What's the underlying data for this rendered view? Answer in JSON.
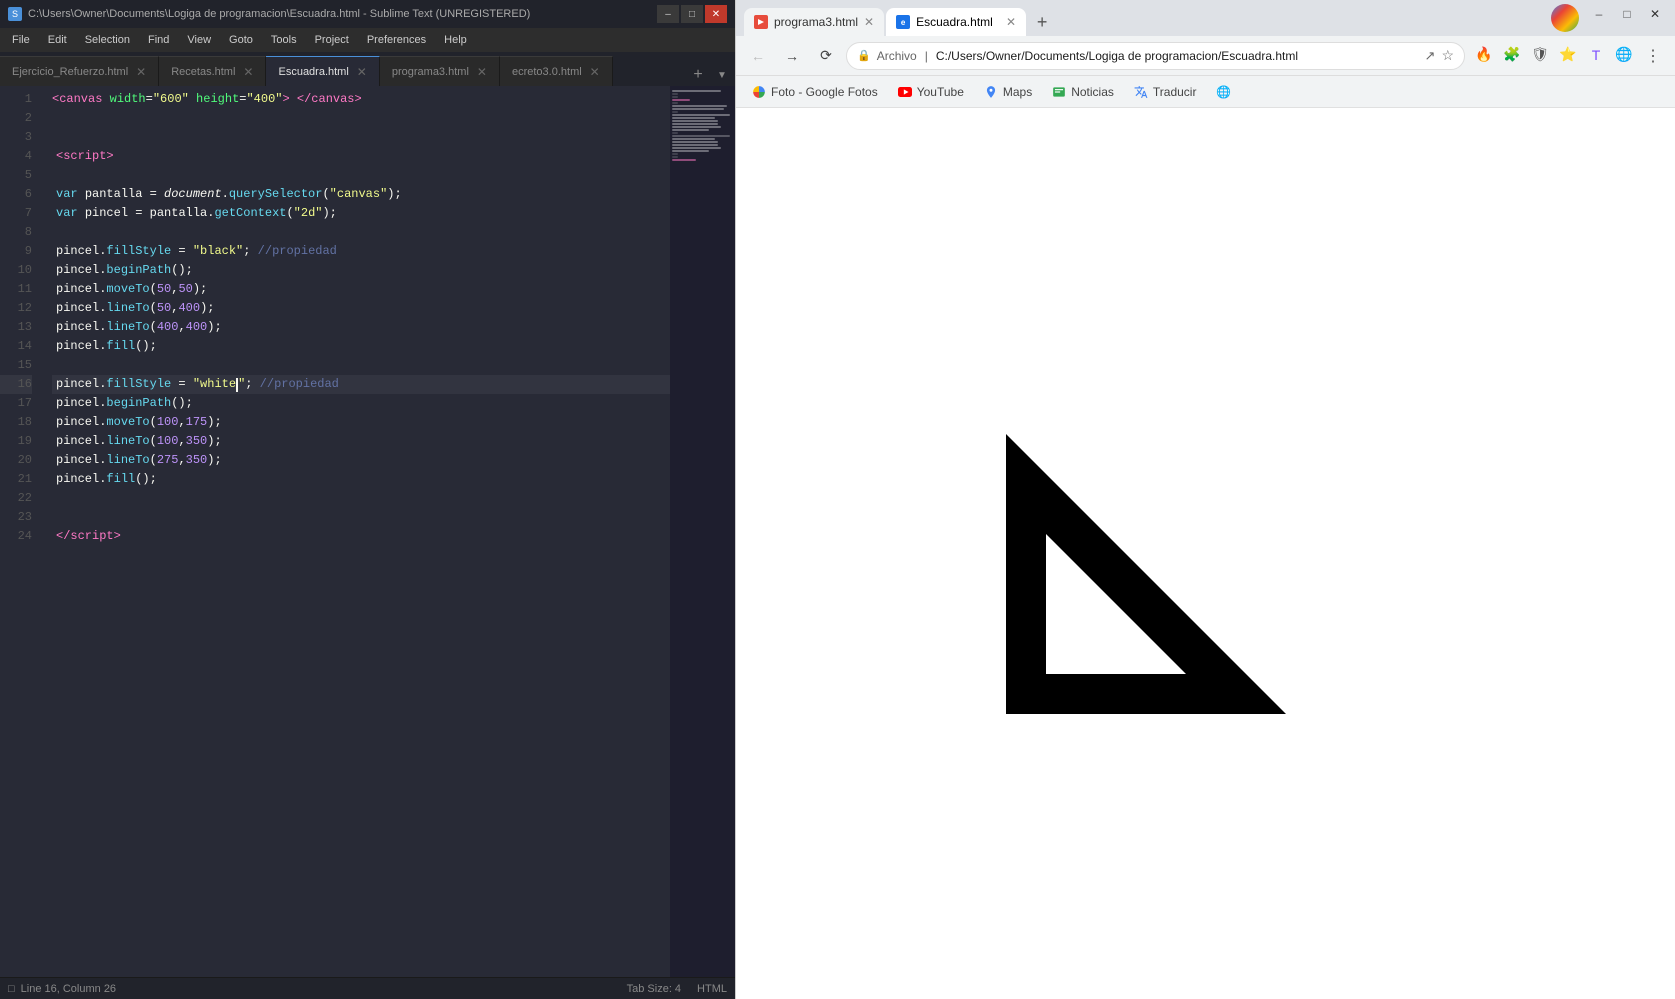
{
  "sublime": {
    "title": "C:\\Users\\Owner\\Documents\\Logiga de programacion\\Escuadra.html - Sublime Text (UNREGISTERED)",
    "tabs": [
      {
        "label": "Ejercicio_Refuerzo.html",
        "active": false
      },
      {
        "label": "Recetas.html",
        "active": false
      },
      {
        "label": "Escuadra.html",
        "active": true
      },
      {
        "label": "programa3.html",
        "active": false
      },
      {
        "label": "ecreto3.0.html",
        "active": false
      }
    ],
    "menu": [
      "File",
      "Edit",
      "Selection",
      "Find",
      "View",
      "Goto",
      "Tools",
      "Project",
      "Preferences",
      "Help"
    ],
    "lines": [
      {
        "num": 1,
        "code": "canvas_tag"
      },
      {
        "num": 2,
        "code": "blank"
      },
      {
        "num": 3,
        "code": "blank"
      },
      {
        "num": 4,
        "code": "script_open"
      },
      {
        "num": 5,
        "code": "blank"
      },
      {
        "num": 6,
        "code": "var_pantalla"
      },
      {
        "num": 7,
        "code": "var_pincel"
      },
      {
        "num": 8,
        "code": "blank"
      },
      {
        "num": 9,
        "code": "fill_black"
      },
      {
        "num": 10,
        "code": "beginPath"
      },
      {
        "num": 11,
        "code": "moveTo_50_50"
      },
      {
        "num": 12,
        "code": "lineTo_50_400"
      },
      {
        "num": 13,
        "code": "lineTo_400_400"
      },
      {
        "num": 14,
        "code": "fill"
      },
      {
        "num": 15,
        "code": "blank"
      },
      {
        "num": 16,
        "code": "fill_white"
      },
      {
        "num": 17,
        "code": "beginPath2"
      },
      {
        "num": 18,
        "code": "moveTo_100_175"
      },
      {
        "num": 19,
        "code": "lineTo_100_350"
      },
      {
        "num": 20,
        "code": "lineTo_275_350"
      },
      {
        "num": 21,
        "code": "fill2"
      },
      {
        "num": 22,
        "code": "blank"
      },
      {
        "num": 23,
        "code": "blank"
      },
      {
        "num": 24,
        "code": "script_close"
      }
    ],
    "status": {
      "line": "Line 16, Column 26",
      "tab_size": "Tab Size: 4",
      "syntax": "HTML"
    }
  },
  "chrome": {
    "tabs": [
      {
        "label": "programa3.html",
        "active": false
      },
      {
        "label": "Escuadra.html",
        "active": true
      }
    ],
    "address": "C:/Users/Owner/Docu...",
    "address_full": "C:/Users/Owner/Documents/Logiga de programacion/Escuadra.html",
    "bookmarks": [
      {
        "label": "Foto - Google Fotos",
        "type": "photos"
      },
      {
        "label": "YouTube",
        "type": "youtube"
      },
      {
        "label": "Maps",
        "type": "maps"
      },
      {
        "label": "Noticias",
        "type": "news"
      },
      {
        "label": "Traducir",
        "type": "translate"
      },
      {
        "label": "",
        "type": "globe"
      }
    ]
  }
}
